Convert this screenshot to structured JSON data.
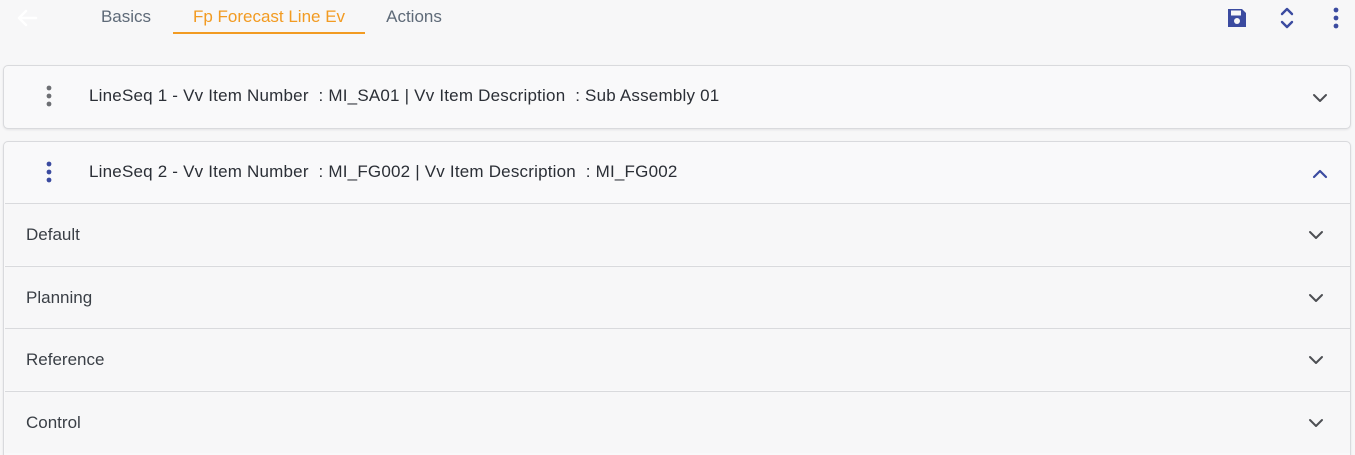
{
  "header": {
    "tabs": [
      {
        "label": "Basics",
        "active": false
      },
      {
        "label": "Fp Forecast Line Ev",
        "active": true
      },
      {
        "label": "Actions",
        "active": false
      }
    ],
    "icons": {
      "back": "back-arrow-icon",
      "save": "save-icon",
      "expand_collapse": "expand-collapse-icon",
      "more": "more-vertical-icon"
    },
    "colors": {
      "accent": "#f29b22",
      "primary": "#3b4ba0",
      "tab_text": "#5e6a78"
    }
  },
  "lines": [
    {
      "title": "LineSeq 1 - Vv Item Number  : MI_SA01 | Vv Item Description  : Sub Assembly 01",
      "expanded": false
    },
    {
      "title": "LineSeq 2 - Vv Item Number  : MI_FG002 | Vv Item Description  : MI_FG002",
      "expanded": true,
      "sections": [
        {
          "label": "Default"
        },
        {
          "label": "Planning"
        },
        {
          "label": "Reference"
        },
        {
          "label": "Control"
        }
      ]
    }
  ]
}
